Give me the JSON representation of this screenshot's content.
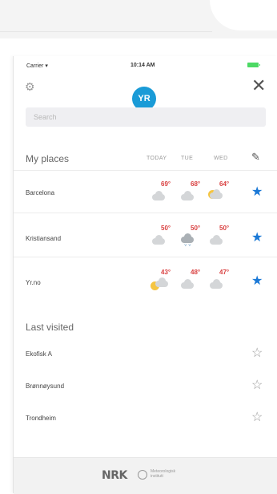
{
  "status": {
    "carrier": "Carrier ▾",
    "time": "10:14 AM"
  },
  "logo": "YR",
  "search": {
    "placeholder": "Search"
  },
  "my_places": {
    "title": "My places",
    "days": [
      "TODAY",
      "TUE",
      "WED"
    ],
    "places": [
      {
        "name": "Barcelona",
        "temps": [
          "69°",
          "68°",
          "64°"
        ],
        "icons": [
          "cloud-icon",
          "cloud-icon",
          "partly-sunny-icon"
        ],
        "starred": true
      },
      {
        "name": "Kristiansand",
        "temps": [
          "50°",
          "50°",
          "50°"
        ],
        "icons": [
          "cloud-icon",
          "rain-cloud-icon",
          "cloud-icon"
        ],
        "starred": true
      },
      {
        "name": "Yr.no",
        "temps": [
          "43°",
          "48°",
          "47°"
        ],
        "icons": [
          "partly-sunny-icon",
          "cloud-icon",
          "cloud-icon"
        ],
        "starred": true
      }
    ]
  },
  "last_visited": {
    "title": "Last visited",
    "places": [
      {
        "name": "Ekofisk A",
        "starred": false
      },
      {
        "name": "Brønnøysund",
        "starred": false
      },
      {
        "name": "Trondheim",
        "starred": false
      }
    ]
  },
  "footer": {
    "nrk": "NRK",
    "met_line1": "Meteorologisk",
    "met_line2": "institutt"
  },
  "colors": {
    "accent": "#1a78d6",
    "temp": "#d94040",
    "logo_bg": "#1a9bd7"
  }
}
